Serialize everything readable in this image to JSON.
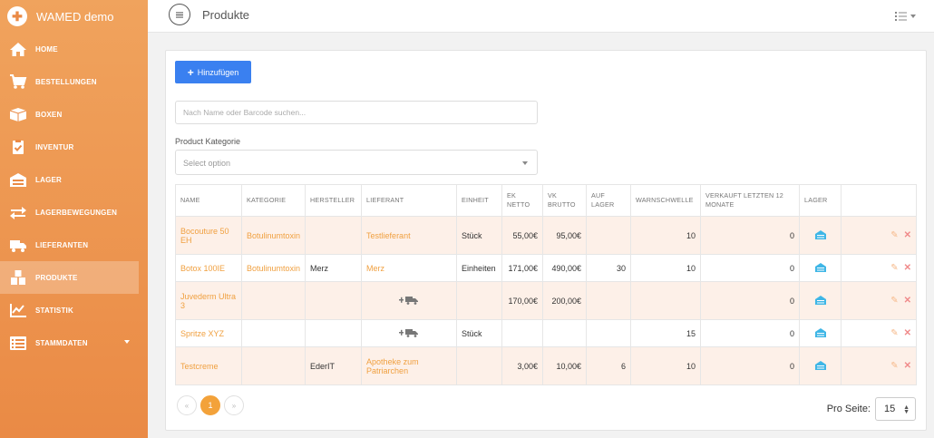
{
  "app": {
    "title": "WAMED demo"
  },
  "sidebar": {
    "items": [
      {
        "label": "HOME",
        "icon": "home-icon"
      },
      {
        "label": "BESTELLUNGEN",
        "icon": "cart-icon"
      },
      {
        "label": "BOXEN",
        "icon": "box-icon"
      },
      {
        "label": "INVENTUR",
        "icon": "clipboard-check-icon"
      },
      {
        "label": "LAGER",
        "icon": "warehouse-icon"
      },
      {
        "label": "LAGERBEWEGUNGEN",
        "icon": "exchange-icon"
      },
      {
        "label": "LIEFERANTEN",
        "icon": "truck-icon"
      },
      {
        "label": "PRODUKTE",
        "icon": "boxes-icon",
        "active": true
      },
      {
        "label": "STATISTIK",
        "icon": "chart-icon"
      },
      {
        "label": "STAMMDATEN",
        "icon": "list-icon",
        "dropdown": true
      }
    ]
  },
  "header": {
    "title": "Produkte"
  },
  "toolbar": {
    "add_label": "Hinzufügen"
  },
  "search": {
    "placeholder": "Nach Name oder Barcode suchen..."
  },
  "filter": {
    "label": "Product Kategorie",
    "placeholder": "Select option"
  },
  "table": {
    "headers": [
      "NAME",
      "KATEGORIE",
      "HERSTELLER",
      "LIEFERANT",
      "EINHEIT",
      "EK NETTO",
      "VK BRUTTO",
      "AUF LAGER",
      "WARNSCHWELLE",
      "VERKAUFT LETZTEN 12 MONATE",
      "LAGER"
    ],
    "rows": [
      {
        "name": "Bocouture 50 EH",
        "kategorie": "Botulinumtoxin",
        "hersteller": "",
        "lieferant": "Testlieferant",
        "lieferant_icon": false,
        "einheit": "Stück",
        "ek": "55,00€",
        "vk": "95,00€",
        "lager": "",
        "warn": "10",
        "verkauft": "0"
      },
      {
        "name": "Botox 100IE",
        "kategorie": "Botulinumtoxin",
        "hersteller": "Merz",
        "lieferant": "Merz",
        "lieferant_icon": false,
        "einheit": "Einheiten",
        "ek": "171,00€",
        "vk": "490,00€",
        "lager": "30",
        "warn": "10",
        "verkauft": "0"
      },
      {
        "name": "Juvederm Ultra 3",
        "kategorie": "",
        "hersteller": "",
        "lieferant": "",
        "lieferant_icon": true,
        "einheit": "",
        "ek": "170,00€",
        "vk": "200,00€",
        "lager": "",
        "warn": "",
        "verkauft": "0"
      },
      {
        "name": "Spritze XYZ",
        "kategorie": "",
        "hersteller": "",
        "lieferant": "",
        "lieferant_icon": true,
        "einheit": "Stück",
        "ek": "",
        "vk": "",
        "lager": "",
        "warn": "15",
        "verkauft": "0"
      },
      {
        "name": "Testcreme",
        "kategorie": "",
        "hersteller": "EderIT",
        "lieferant": "Apotheke zum Patriarchen",
        "lieferant_icon": false,
        "einheit": "",
        "ek": "3,00€",
        "vk": "10,00€",
        "lager": "6",
        "warn": "10",
        "verkauft": "0"
      }
    ]
  },
  "pagination": {
    "prev": "«",
    "current": "1",
    "next": "»",
    "per_page_label": "Pro Seite:",
    "per_page_value": "15"
  },
  "colors": {
    "sidebar": "#ea8a45",
    "accent": "#3a80f0",
    "link": "#f0a040",
    "row_highlight": "#fdf0e8",
    "stock_icon": "#3fb6e6"
  }
}
